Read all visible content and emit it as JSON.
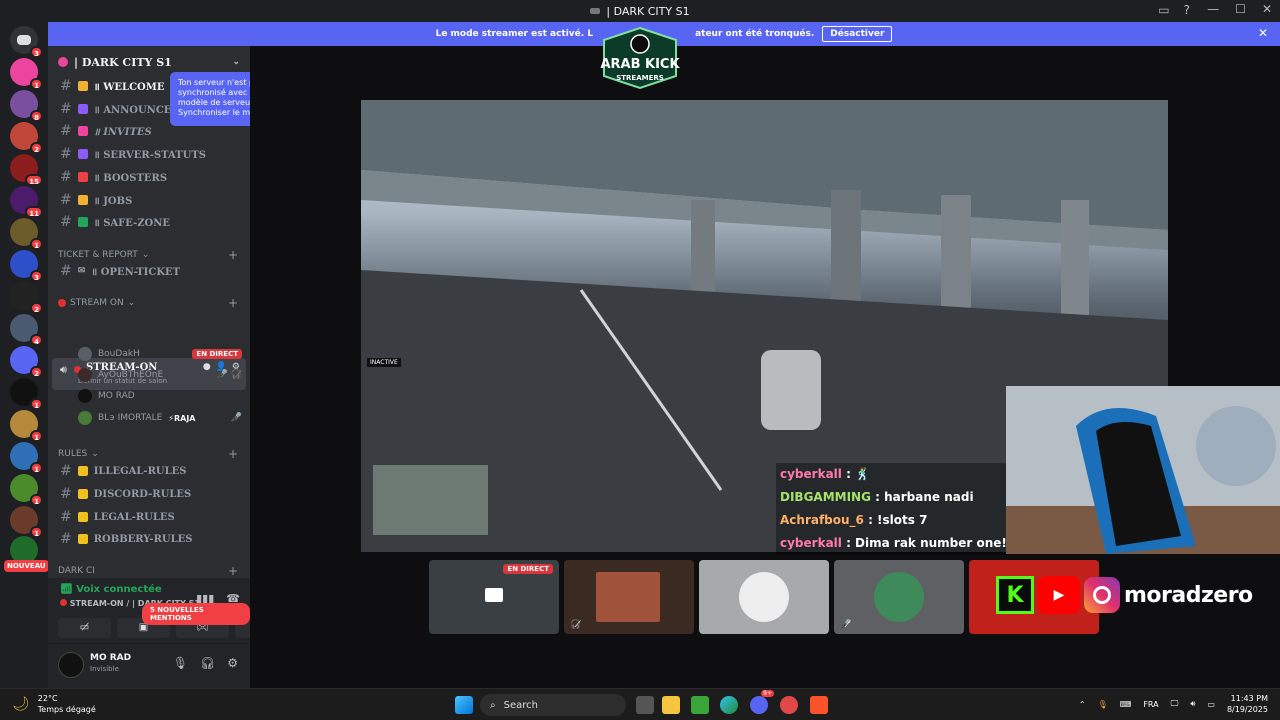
{
  "window": {
    "title": "| DARK CITY S1",
    "icons": [
      "inbox-icon",
      "help-icon"
    ],
    "controls": [
      "—",
      "☐",
      "✕"
    ]
  },
  "banner": {
    "text": "Le mode streamer est activé. L",
    "text_tail": "ateur ont été tronqués.",
    "button": "Désactiver"
  },
  "guild_badges": [
    "3",
    "1",
    "8",
    "2",
    "15",
    "11",
    "1",
    "3",
    "2",
    "4",
    "2",
    "1",
    "1",
    "1",
    "1",
    "1"
  ],
  "nouveau": "NOUVEAU",
  "server": {
    "name": "| DARK CITY S1"
  },
  "channels": [
    {
      "label": "॥ WELCOME",
      "emoji_color": "#f0b232",
      "emoji": "👋"
    },
    {
      "label": "॥ ANNOUNCEME",
      "emoji_color": "#8b5cf6",
      "emoji": "🎉"
    },
    {
      "label": "॥ INVITES",
      "emoji_color": "#eb459e",
      "emoji": "💌"
    },
    {
      "label": "॥ SERVER-STATUTS",
      "emoji_color": "#8b5cf6",
      "emoji": "🎉"
    },
    {
      "label": "॥ BOOSTERS",
      "emoji_color": "#ed4245",
      "emoji": "🚀"
    },
    {
      "label": "॥ JOBS",
      "emoji_color": "#f0b232",
      "emoji": "📜"
    },
    {
      "label": "॥ SAFE-ZONE",
      "emoji_color": "#23a55a",
      "emoji": "✅"
    }
  ],
  "category_ticket": "TICKET & REPORT",
  "ticket_channel": "॥ OPEN-TICKET",
  "category_stream": "STREAM ON",
  "voice_channel": {
    "name": "STREAM-ON",
    "status": "Définir un statut de salon"
  },
  "voice_users": [
    {
      "name": "BouDakH",
      "live": "EN DIRECT"
    },
    {
      "name": "AyOuBThEOnE",
      "live": ""
    },
    {
      "name": "MO RAD",
      "live": ""
    },
    {
      "name": "BL϶ IMORTALE",
      "tag": "⚡RAJA"
    }
  ],
  "category_rules": "RULES",
  "rules_channels": [
    "ILLEGAL-RULES",
    "DISCORD-RULES",
    "LEGAL-RULES",
    "ROBBERY-RULES"
  ],
  "category_dark": "DARK CI",
  "mentions": "5 NOUVELLES MENTIONS",
  "tooltip": "Ton serveur n'est pas synchronisé avec ton modèle de serveur. Synchroniser le modèle ?",
  "voice_panel": {
    "status": "Voix connectée",
    "where": "STREAM-ON / | DARK CITY S1"
  },
  "user": {
    "name": "MO RAD",
    "status": "Invisible"
  },
  "logo": {
    "line1": "ARAB KICK",
    "line2": "STREAMERS"
  },
  "hud": {
    "inactive": "INACTIVE"
  },
  "chat": [
    {
      "user": "cyberkall",
      "msg": " : 🕺",
      "color": "#ff7aa8"
    },
    {
      "user": "DIBGAMMING",
      "msg": " : harbane nadi",
      "color": "#a6e26c"
    },
    {
      "user": "Achrafbou_6",
      "msg": " : !slots 7",
      "color": "#ffb066"
    },
    {
      "user": "cyberkall",
      "msg": " : Dima rak number one!",
      "color": "#ff7aa8"
    }
  ],
  "tiles": {
    "live_label": "EN DIRECT"
  },
  "socials": {
    "handle": "moradzero",
    "kick_letter": "K"
  },
  "taskbar": {
    "temp": "22°C",
    "weather": "Temps dégagé",
    "search": "Search",
    "lang": "FRA",
    "time": "11:43 PM",
    "date": "8/19/2025",
    "discord_badge": "9+"
  }
}
